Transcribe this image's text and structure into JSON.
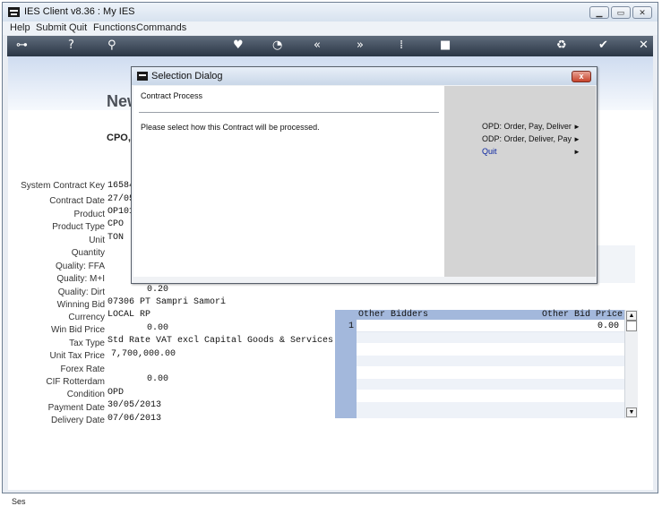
{
  "window": {
    "title": "IES Client v8.36 : My IES",
    "controls": [
      "minimize",
      "maximize",
      "close"
    ]
  },
  "menu": [
    "Help",
    "Submit",
    "Quit",
    "Functions",
    "Commands"
  ],
  "toolbar": {
    "icons": [
      "key-icon",
      "help-icon",
      "search-icon",
      "heart-icon",
      "clock-icon",
      "back-icon",
      "forward-icon",
      "text-cursor-icon",
      "stop-icon",
      "recycle-icon",
      "check-icon",
      "close-icon"
    ],
    "glyphs": [
      "⊶",
      "?",
      "⚲",
      "♥",
      "◔",
      "«",
      "»",
      "⁞",
      "■",
      "♻",
      "✔",
      "✕"
    ]
  },
  "page": {
    "heading": "New",
    "subheading": "CPO, K",
    "fields": [
      {
        "label": "System Contract Key",
        "value": "165848"
      },
      {
        "label": "Contract Date",
        "value": "27/05/"
      },
      {
        "label": "Product",
        "value": "OP101"
      },
      {
        "label": "Product Type",
        "value": "CPO"
      },
      {
        "label": "Unit",
        "value": "TON"
      },
      {
        "label": "Quantity",
        "value": ""
      },
      {
        "label": "Quality: FFA",
        "value": ""
      },
      {
        "label": "Quality: M+I",
        "value": ""
      },
      {
        "label": "Quality: Dirt",
        "value": "0.20"
      },
      {
        "label": "Winning Bid",
        "value": "07306 PT Sampri Samori"
      },
      {
        "label": "Currency",
        "value": "LOCAL RP"
      },
      {
        "label": "Win Bid Price",
        "value": "0.00"
      },
      {
        "label": "Tax Type",
        "value": "Std Rate VAT excl Capital Goods & Services"
      },
      {
        "label": "Unit Tax Price",
        "value": "7,700,000.00"
      },
      {
        "label": "Forex Rate",
        "value": ""
      },
      {
        "label": "CIF Rotterdam",
        "value": "0.00"
      },
      {
        "label": "Condition",
        "value": "OPD"
      },
      {
        "label": "Payment Date",
        "value": "30/05/2013"
      },
      {
        "label": "Delivery Date",
        "value": "07/06/2013"
      }
    ],
    "bottom_left": "Ses",
    "bidders": {
      "col1": "Other Bidders",
      "col2": "Other Bid Price",
      "rows": [
        {
          "num": "1",
          "bidder": "",
          "price": "0.00"
        }
      ]
    }
  },
  "dialog": {
    "title": "Selection Dialog",
    "heading": "Contract Process",
    "message": "Please select how this Contract will be processed.",
    "options": [
      {
        "label": "OPD: Order, Pay, Deliver",
        "arrow": "►"
      },
      {
        "label": "ODP: Order, Deliver, Pay",
        "arrow": "►"
      },
      {
        "label": "Quit",
        "arrow": "►"
      }
    ],
    "close_label": "x"
  }
}
